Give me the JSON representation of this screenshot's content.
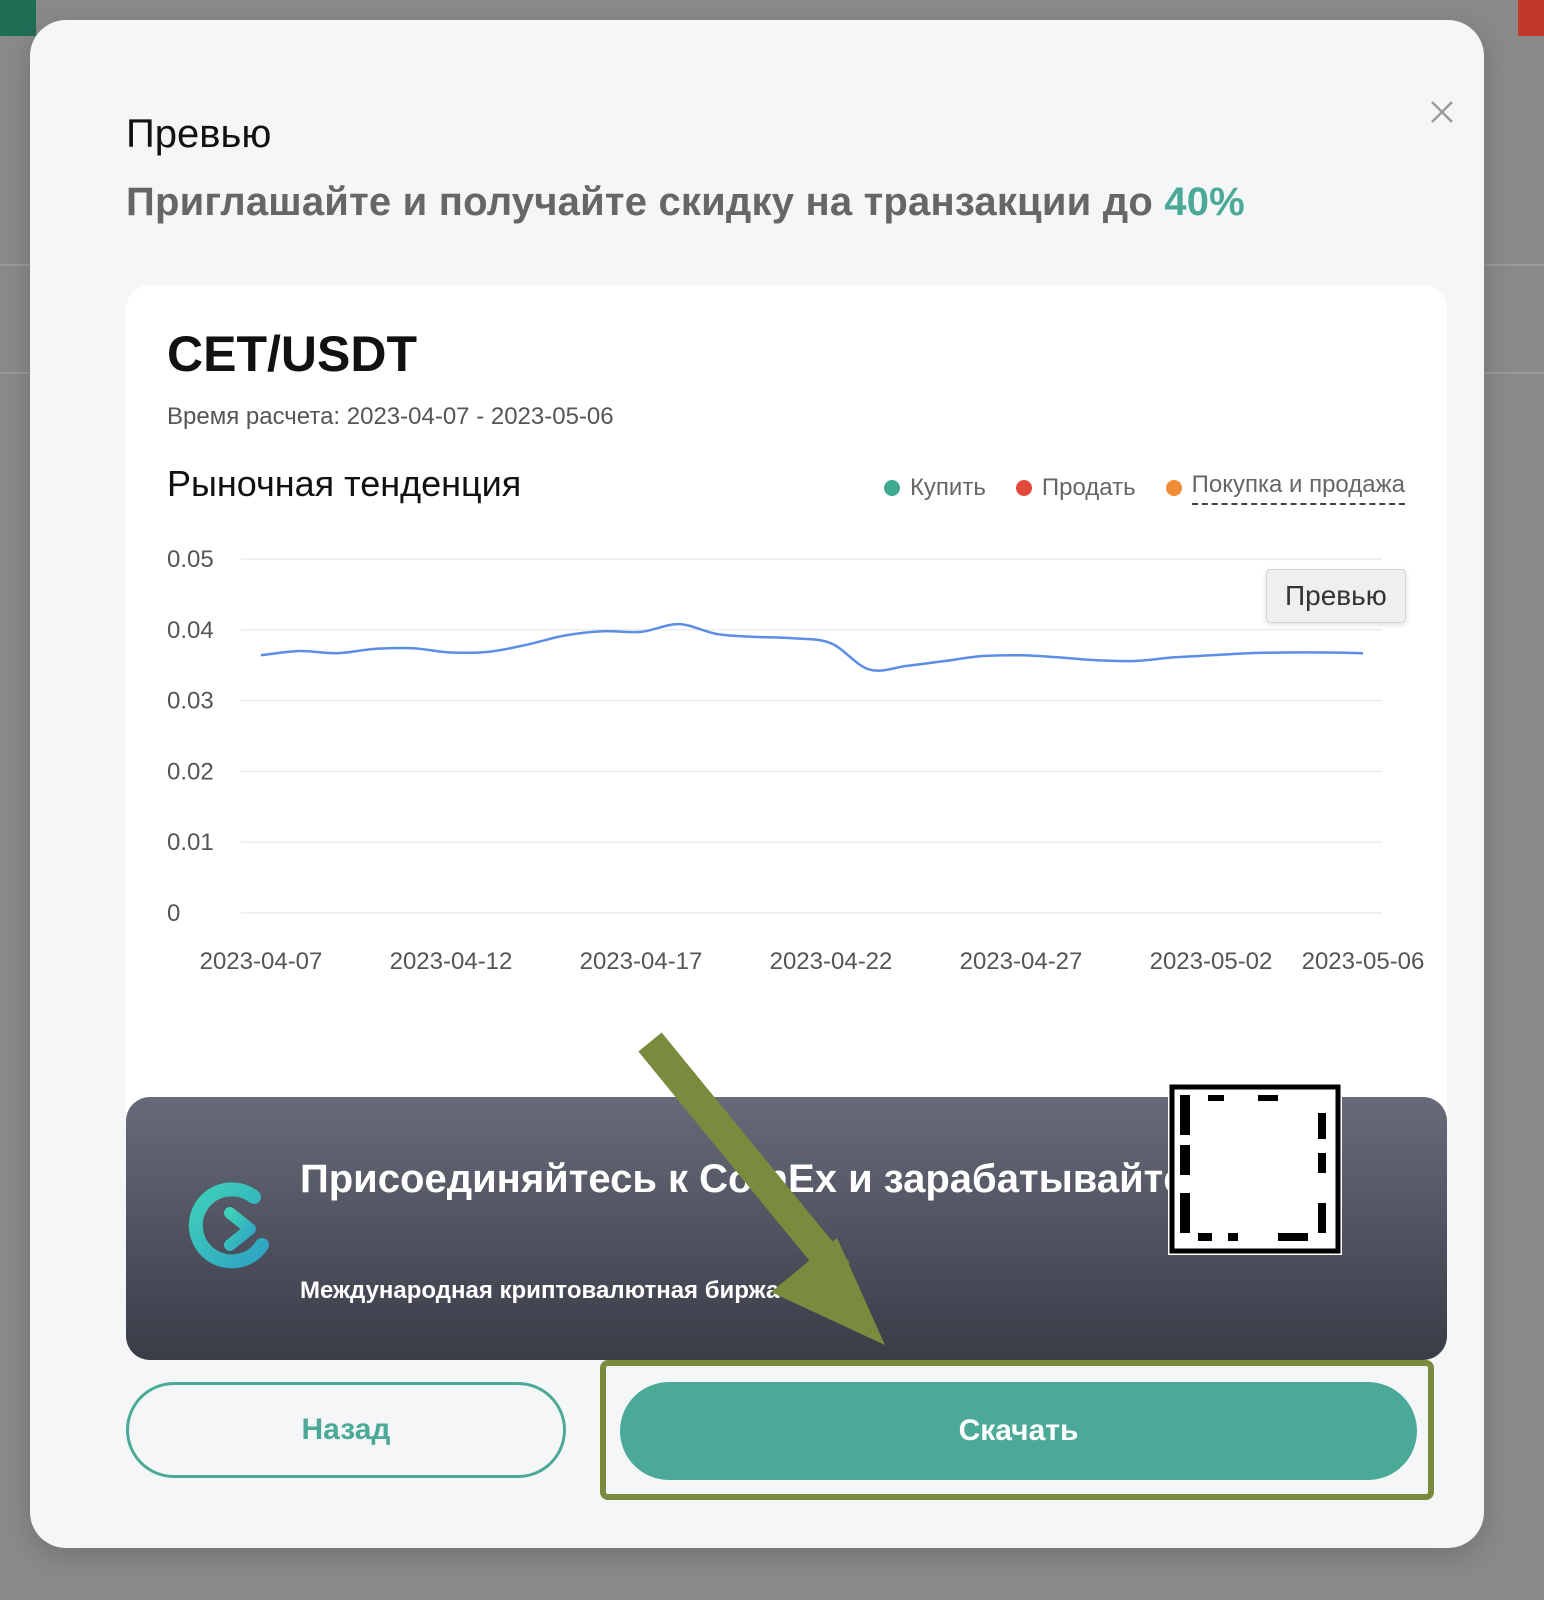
{
  "modal": {
    "title": "Превью",
    "promo_text": "Приглашайте и получайте скидку на транзакции до ",
    "promo_accent": "40%"
  },
  "card": {
    "pair": "CET/USDT",
    "period_label": "Время расчета: ",
    "period_value": "2023-04-07 - 2023-05-06",
    "trend_title": "Рыночная тенденция",
    "legend": [
      {
        "label": "Купить",
        "color": "#3dab8f"
      },
      {
        "label": "Продать",
        "color": "#e04b3c"
      },
      {
        "label": "Покупка и продажа",
        "color": "#f28c38"
      }
    ],
    "tooltip": "Превью"
  },
  "chart_data": {
    "type": "line",
    "x_ticks": [
      "2023-04-07",
      "2023-04-12",
      "2023-04-17",
      "2023-04-22",
      "2023-04-27",
      "2023-05-02",
      "2023-05-06"
    ],
    "y_ticks": [
      "0.05",
      "0.04",
      "0.03",
      "0.02",
      "0.01",
      "0"
    ],
    "ylim": [
      0,
      0.05
    ],
    "grid": true,
    "series": [
      {
        "color": "#5b8ee6",
        "x": [
          "2023-04-07",
          "2023-04-08",
          "2023-04-09",
          "2023-04-10",
          "2023-04-11",
          "2023-04-12",
          "2023-04-13",
          "2023-04-14",
          "2023-04-15",
          "2023-04-16",
          "2023-04-17",
          "2023-04-18",
          "2023-04-19",
          "2023-04-20",
          "2023-04-21",
          "2023-04-22",
          "2023-04-23",
          "2023-04-24",
          "2023-04-25",
          "2023-04-26",
          "2023-04-27",
          "2023-04-28",
          "2023-04-29",
          "2023-04-30",
          "2023-05-01",
          "2023-05-02",
          "2023-05-03",
          "2023-05-04",
          "2023-05-05",
          "2023-05-06"
        ],
        "values": [
          0.0364,
          0.037,
          0.0367,
          0.0373,
          0.0374,
          0.0368,
          0.0369,
          0.0379,
          0.0392,
          0.0398,
          0.0397,
          0.0408,
          0.0394,
          0.039,
          0.0388,
          0.0381,
          0.0344,
          0.0349,
          0.0356,
          0.0363,
          0.0364,
          0.0361,
          0.0357,
          0.0356,
          0.0361,
          0.0364,
          0.0367,
          0.0368,
          0.0368,
          0.0367
        ]
      }
    ]
  },
  "banner": {
    "headline": "Присоединяйтесь к CoinEx и зарабатывайте с нами",
    "subtitle": "Международная криптовалютная биржа"
  },
  "buttons": {
    "back": "Назад",
    "download": "Скачать"
  },
  "colors": {
    "accent": "#4aaa97",
    "highlight": "#7b8b3e",
    "line": "#5b8ee6"
  }
}
